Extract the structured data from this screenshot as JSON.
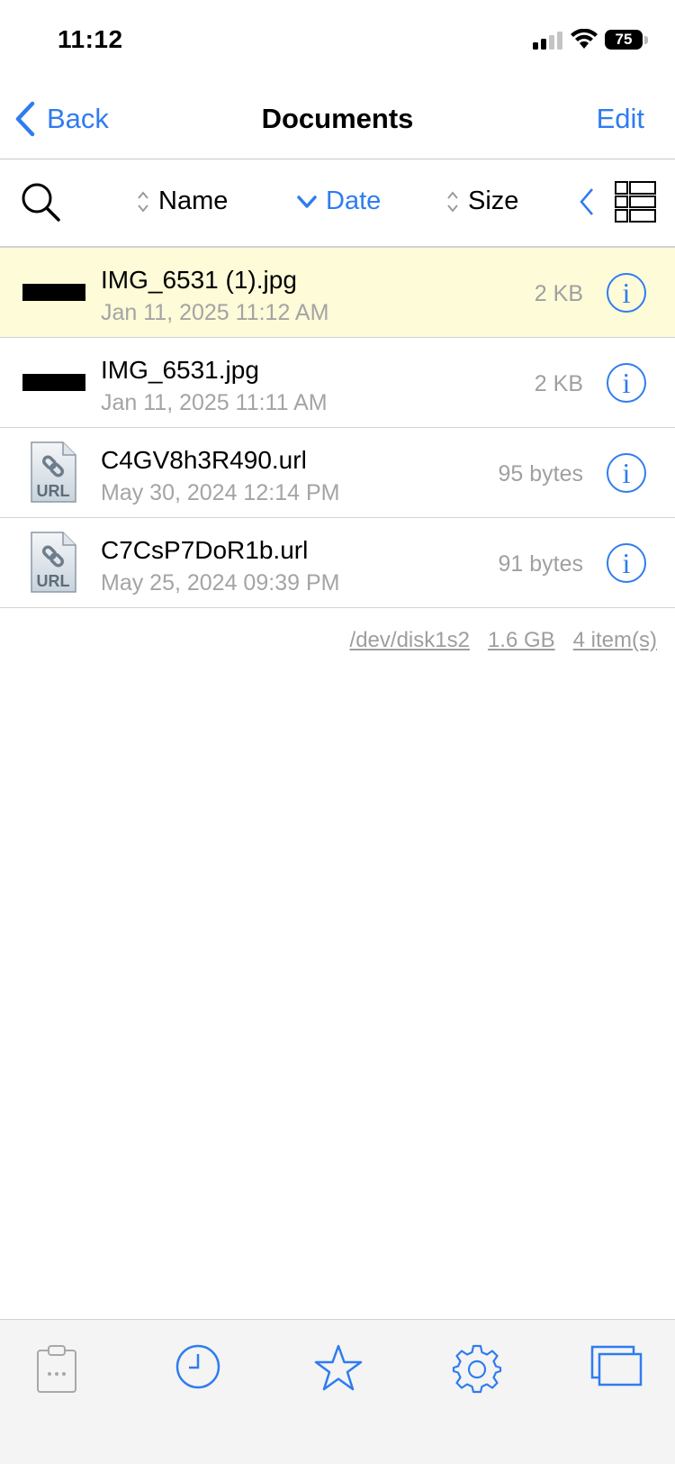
{
  "status_bar": {
    "time": "11:12",
    "battery": "75"
  },
  "nav": {
    "back_label": "Back",
    "title": "Documents",
    "edit_label": "Edit"
  },
  "sort_bar": {
    "name_label": "Name",
    "date_label": "Date",
    "size_label": "Size"
  },
  "files": [
    {
      "name": "IMG_6531 (1).jpg",
      "date": "Jan 11, 2025 11:12 AM",
      "size": "2 KB",
      "type": "image",
      "selected": true
    },
    {
      "name": "IMG_6531.jpg",
      "date": "Jan 11, 2025 11:11 AM",
      "size": "2 KB",
      "type": "image",
      "selected": false
    },
    {
      "name": "C4GV8h3R490.url",
      "date": "May 30, 2024 12:14 PM",
      "size": "95 bytes",
      "type": "url",
      "selected": false
    },
    {
      "name": "C7CsP7DoR1b.url",
      "date": "May 25, 2024 09:39 PM",
      "size": "91 bytes",
      "type": "url",
      "selected": false
    }
  ],
  "thumb_label": "URL",
  "info_glyph": "i",
  "disk_info": {
    "device": "/dev/disk1s2",
    "free": "1.6 GB",
    "count": "4 item(s)"
  },
  "tab_bar": {
    "items": [
      "clipboard-icon",
      "clock-icon",
      "star-icon",
      "gear-icon",
      "windows-icon"
    ]
  },
  "colors": {
    "accent": "#2f7cf0",
    "selected_row": "#fdfbd8",
    "secondary_text": "#a4a4a4"
  }
}
